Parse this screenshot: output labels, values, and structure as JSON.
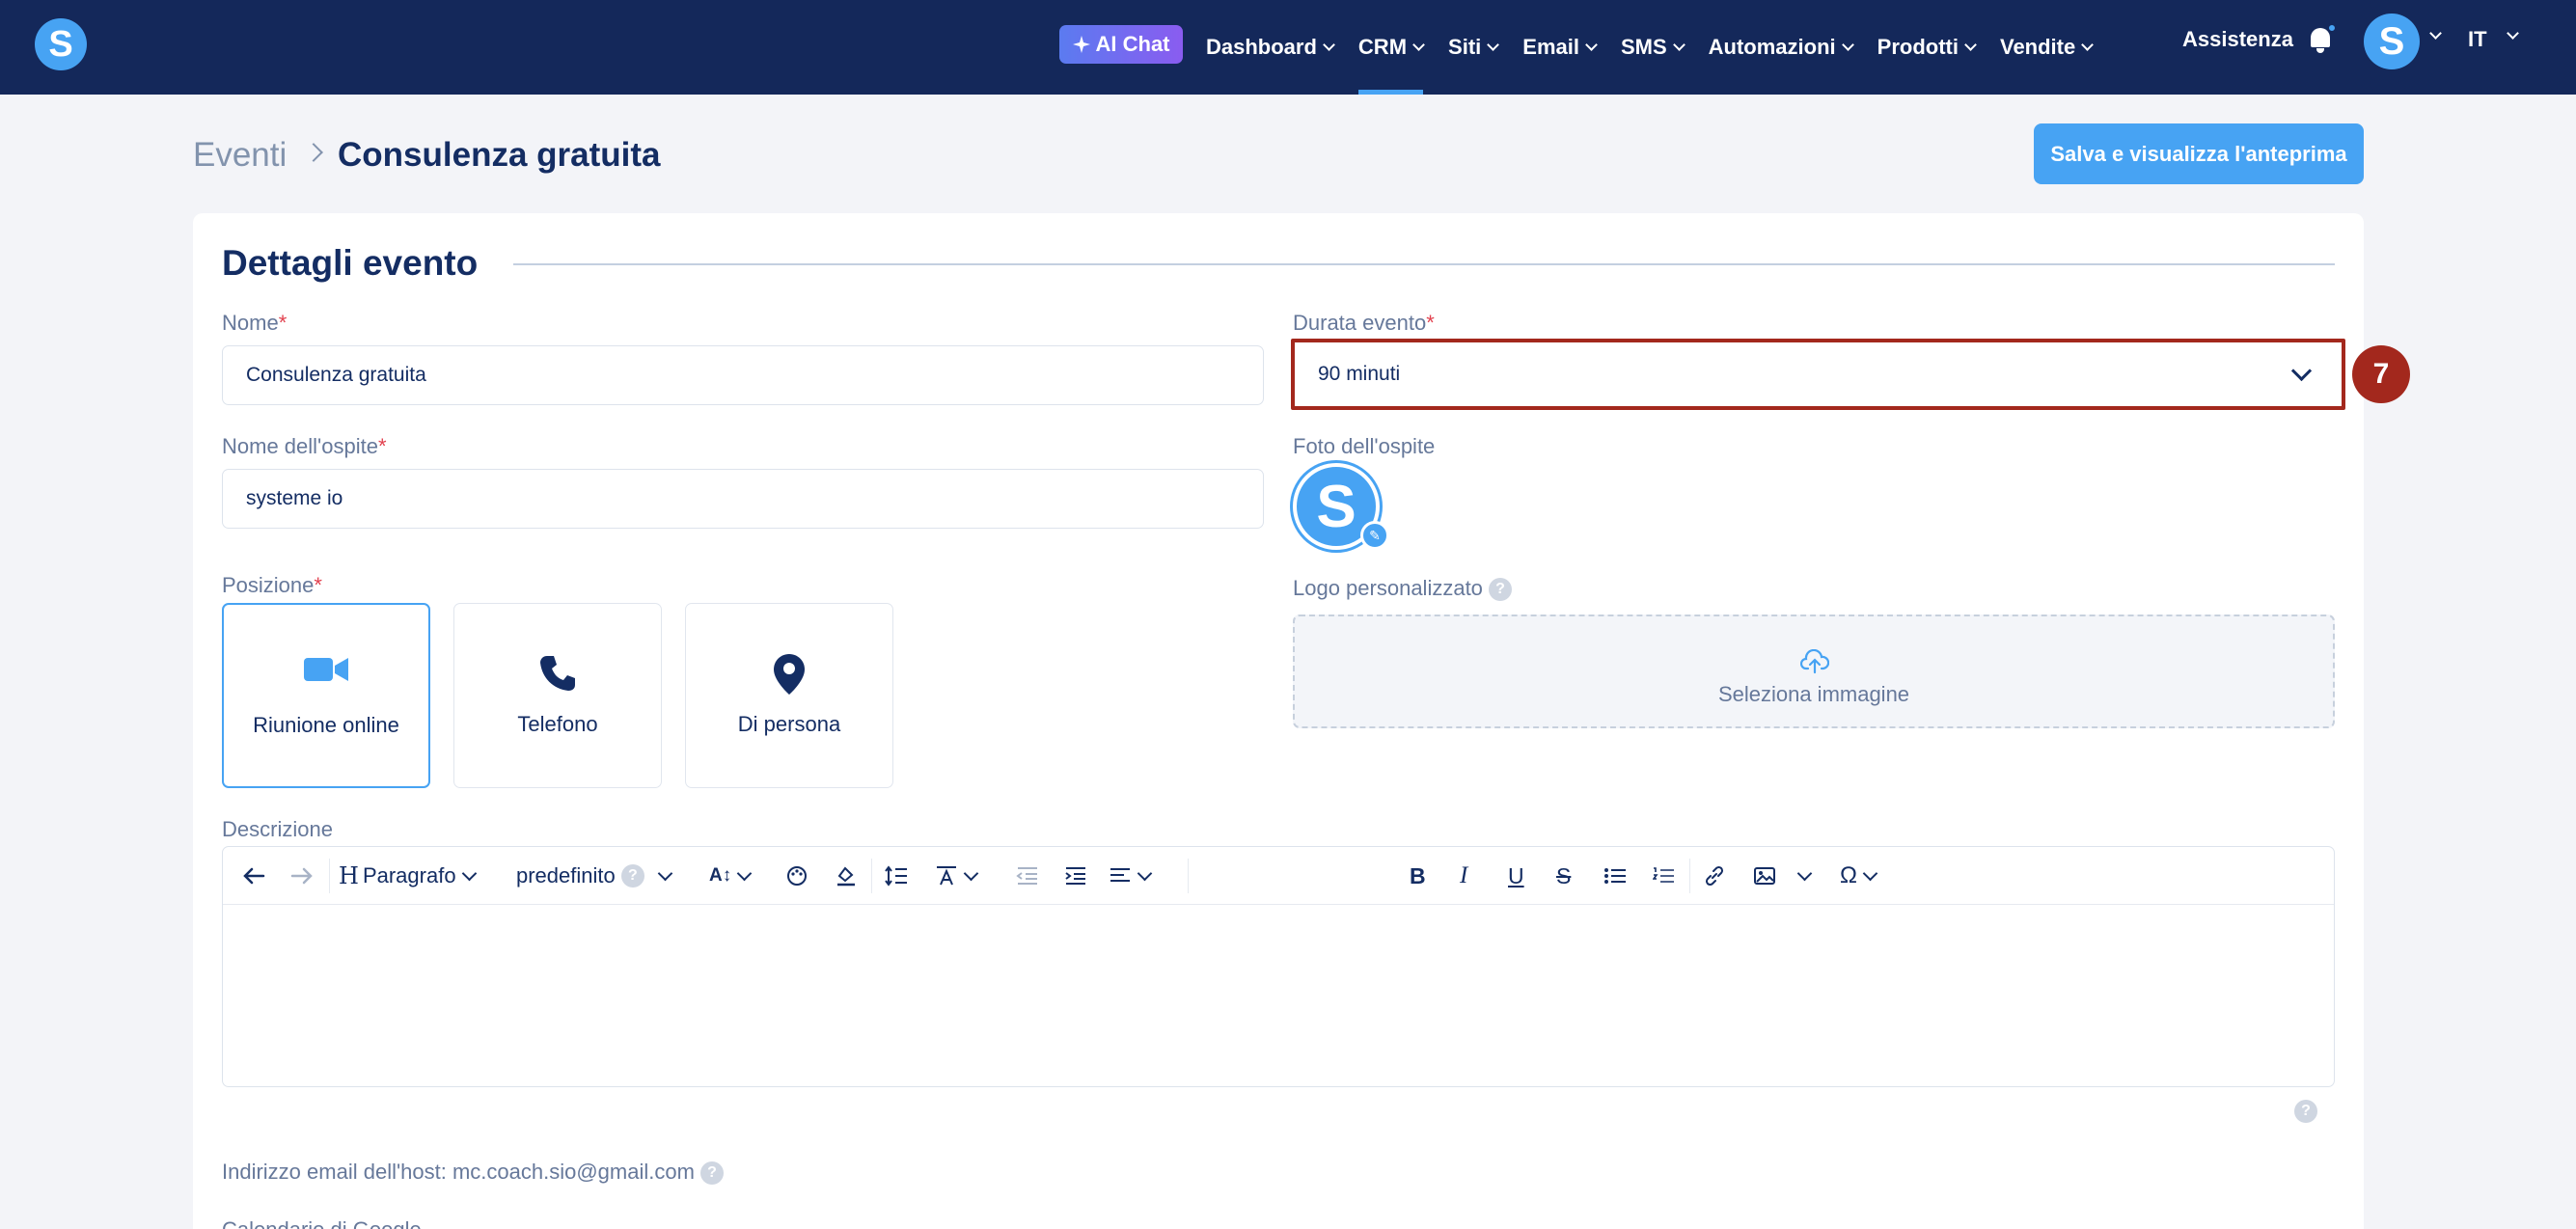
{
  "nav": {
    "logo_letter": "S",
    "ai_chat": "AI Chat",
    "items": [
      {
        "label": "Dashboard"
      },
      {
        "label": "CRM",
        "active": true
      },
      {
        "label": "Siti"
      },
      {
        "label": "Email"
      },
      {
        "label": "SMS"
      },
      {
        "label": "Automazioni"
      },
      {
        "label": "Prodotti"
      },
      {
        "label": "Vendite"
      }
    ],
    "assist": "Assistenza",
    "avatar_letter": "S",
    "lang": "IT"
  },
  "header": {
    "crumb_parent": "Eventi",
    "crumb_current": "Consulenza gratuita",
    "save_button": "Salva e visualizza l'anteprima"
  },
  "section": {
    "title": "Dettagli evento"
  },
  "form": {
    "name_label": "Nome",
    "name_value": "Consulenza gratuita",
    "duration_label": "Durata evento",
    "duration_value": "90 minuti",
    "guest_name_label": "Nome dell'ospite",
    "guest_name_value": "systeme io",
    "guest_photo_label": "Foto dell'ospite",
    "guest_photo_letter": "S",
    "logo_label": "Logo personalizzato",
    "upload_text": "Seleziona immagine",
    "position_label": "Posizione",
    "positions": [
      {
        "label": "Riunione online",
        "icon": "video-icon",
        "selected": true
      },
      {
        "label": "Telefono",
        "icon": "phone-icon",
        "selected": false
      },
      {
        "label": "Di persona",
        "icon": "location-pin-icon",
        "selected": false
      }
    ],
    "description_label": "Descrizione",
    "editor": {
      "paragraph": "Paragrafo",
      "font": "predefinito",
      "content": ""
    },
    "host_email_text": "Indirizzo email dell'host: mc.coach.sio@gmail.com",
    "gcal_text": "Calendario di Google"
  },
  "annotation": {
    "step": "7",
    "color": "#a3281d"
  },
  "colors": {
    "navbar": "#14285a",
    "accent": "#47a3f3",
    "text": "#142d63"
  },
  "required_mark": "*",
  "help_glyph": "?"
}
